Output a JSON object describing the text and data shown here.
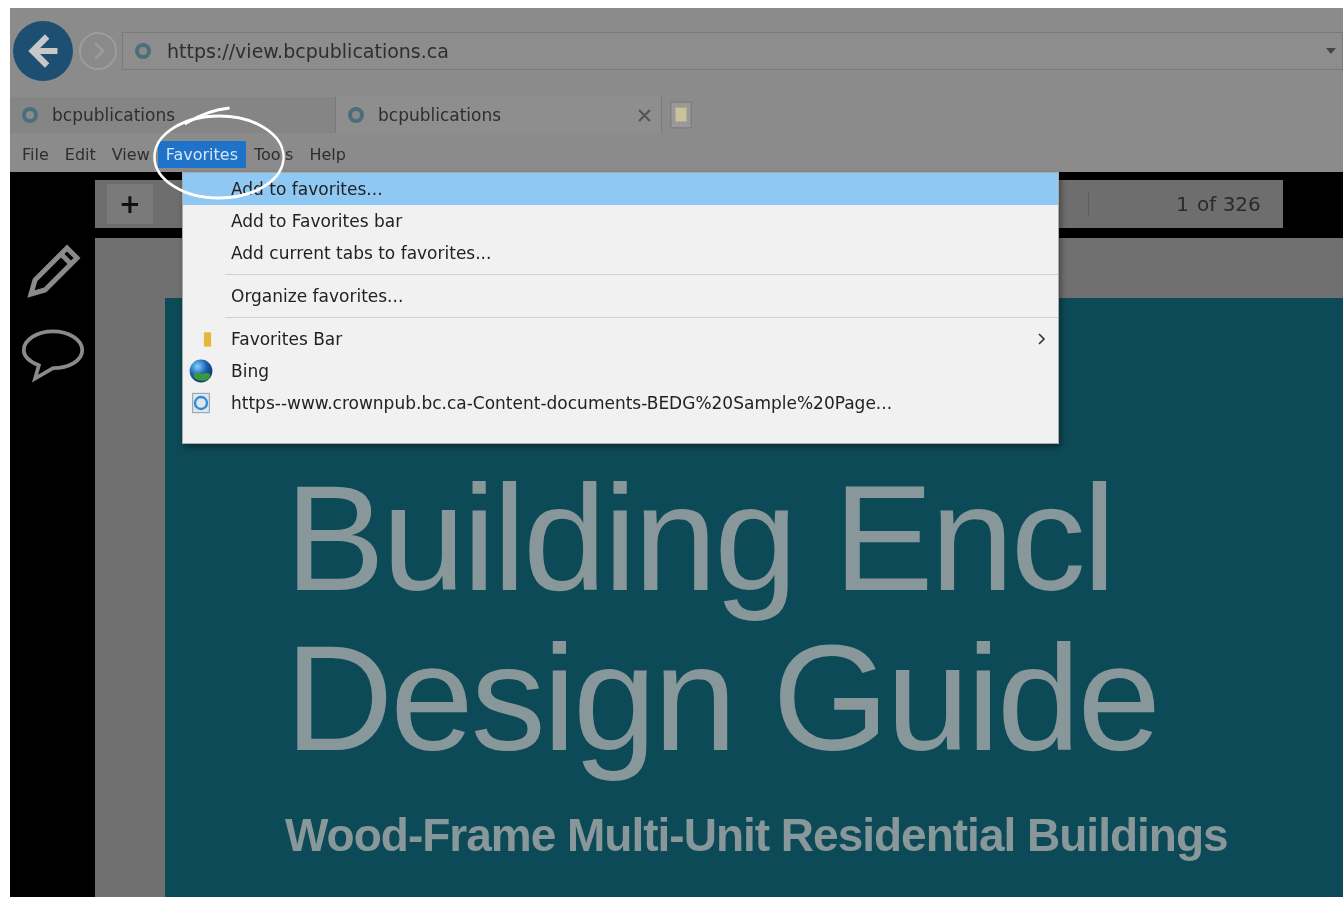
{
  "address_bar": {
    "url": "https://view.bcpublications.ca"
  },
  "tabs": [
    {
      "label": "bcpublications",
      "selected": false
    },
    {
      "label": "bcpublications",
      "selected": true
    }
  ],
  "menu_bar": [
    {
      "label": "File",
      "selected": false
    },
    {
      "label": "Edit",
      "selected": false
    },
    {
      "label": "View",
      "selected": false
    },
    {
      "label": "Favorites",
      "selected": true
    },
    {
      "label": "Tools",
      "selected": false
    },
    {
      "label": "Help",
      "selected": false
    }
  ],
  "favorites_menu": {
    "groups": [
      [
        {
          "kind": "command",
          "label": "Add to favorites...",
          "selected": true
        },
        {
          "kind": "command",
          "label": "Add to Favorites bar",
          "selected": false
        },
        {
          "kind": "command",
          "label": "Add current tabs to favorites...",
          "selected": false
        }
      ],
      [
        {
          "kind": "command",
          "label": "Organize favorites...",
          "selected": false
        }
      ],
      [
        {
          "kind": "folder",
          "label": "Favorites Bar",
          "selected": false
        },
        {
          "kind": "site",
          "label": "Bing",
          "selected": false
        },
        {
          "kind": "page",
          "label": "https--www.crownpub.bc.ca-Content-documents-BEDG%20Sample%20Page...",
          "selected": false
        }
      ]
    ]
  },
  "viewer_toolbar": {
    "zoom_button": "+",
    "page": "1",
    "page_count": "of 326"
  },
  "document": {
    "title_lines": [
      "Building Encl",
      "Design Guide"
    ],
    "subtitle": "Wood-Frame Multi-Unit Residential Buildings"
  }
}
